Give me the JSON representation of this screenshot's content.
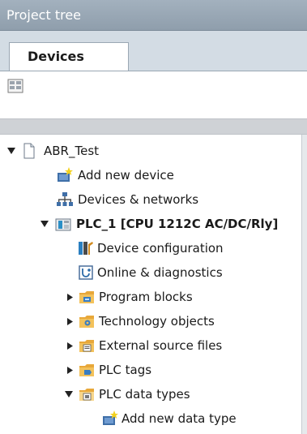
{
  "panel": {
    "title": "Project tree"
  },
  "tabs": [
    {
      "label": "Devices",
      "active": true
    }
  ],
  "toolbar": {
    "button_icon": "grid-view-icon"
  },
  "tree": {
    "items": [
      {
        "label": "ABR_Test",
        "icon": "project-file-icon",
        "expanded": true
      },
      {
        "label": "Add new device",
        "icon": "add-new-star-icon"
      },
      {
        "label": "Devices & networks",
        "icon": "network-icon"
      },
      {
        "label": "PLC_1 [CPU 1212C AC/DC/Rly]",
        "icon": "plc-icon",
        "expanded": true,
        "selected": true
      },
      {
        "label": "Device configuration",
        "icon": "device-configuration-icon"
      },
      {
        "label": "Online & diagnostics",
        "icon": "online-diagnostics-icon"
      },
      {
        "label": "Program blocks",
        "icon": "folder-icon",
        "expanded": false
      },
      {
        "label": "Technology objects",
        "icon": "folder-icon",
        "expanded": false
      },
      {
        "label": "External source files",
        "icon": "folder-icon",
        "expanded": false
      },
      {
        "label": "PLC tags",
        "icon": "folder-icon",
        "expanded": false
      },
      {
        "label": "PLC data types",
        "icon": "folder-icon",
        "expanded": true
      },
      {
        "label": "Add new data type",
        "icon": "add-new-star-icon"
      }
    ]
  },
  "colors": {
    "header": "#98a7b5",
    "tabstrip": "#d3dce4",
    "folder": "#e8a83a"
  }
}
